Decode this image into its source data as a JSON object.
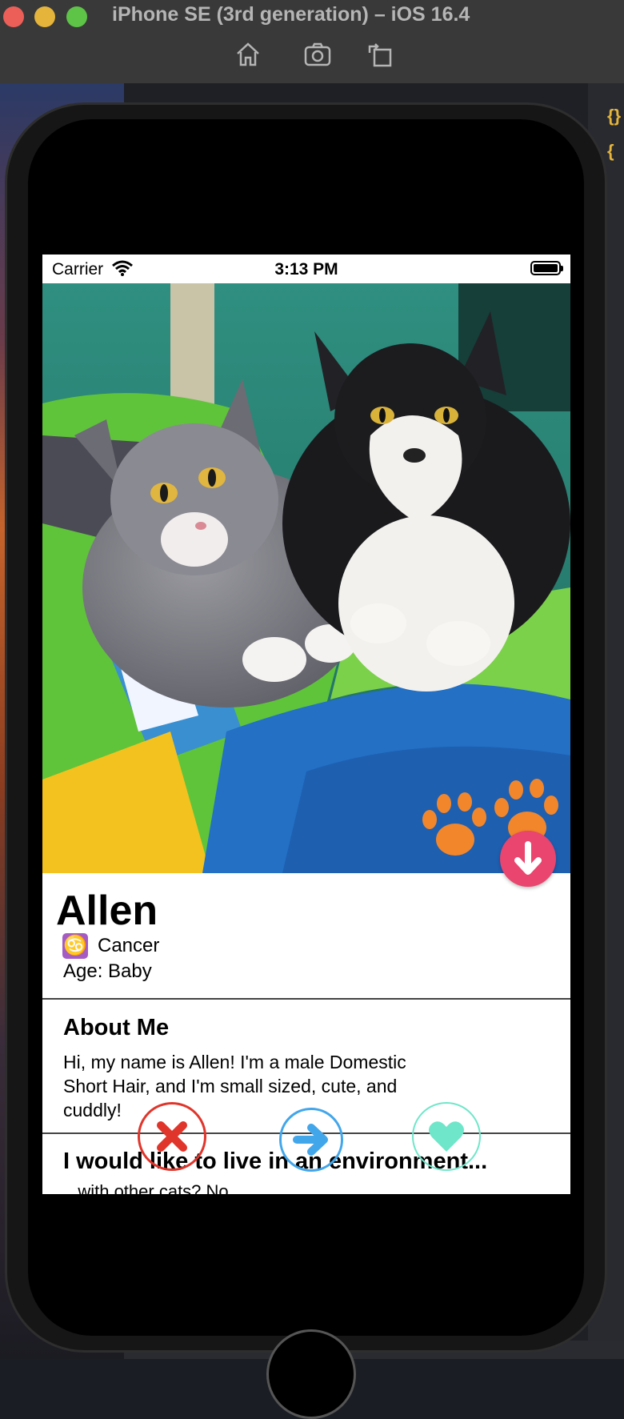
{
  "window": {
    "title": "iPhone SE (3rd generation) – iOS 16.4",
    "toolbar": [
      "home-icon",
      "screenshot-icon",
      "rotate-icon"
    ]
  },
  "status_bar": {
    "carrier": "Carrier",
    "time": "3:13 PM"
  },
  "profile": {
    "name": "Allen",
    "zodiac_symbol": "♋",
    "zodiac": "Cancer",
    "age": "Age: Baby",
    "photo_description_icon": "cat-photo"
  },
  "about": {
    "heading": "About Me",
    "body": "Hi, my name is Allen! I'm a male Domestic Short Hair, and I'm small sized, cute, and cuddly!"
  },
  "environment": {
    "heading": "I would like to live in an environment...",
    "first_line": "...with other cats? No"
  },
  "actions": {
    "dislike_icon": "x-icon",
    "next_icon": "arrow-right-icon",
    "like_icon": "heart-icon",
    "expand_icon": "arrow-down-icon"
  },
  "colors": {
    "accent_pink": "#e9456e",
    "dislike_red": "#e0352b",
    "next_blue": "#42a6ea",
    "like_mint": "#6fe6c9",
    "paw_orange": "#f2862b",
    "zodiac_purple": "#a55bc4"
  }
}
